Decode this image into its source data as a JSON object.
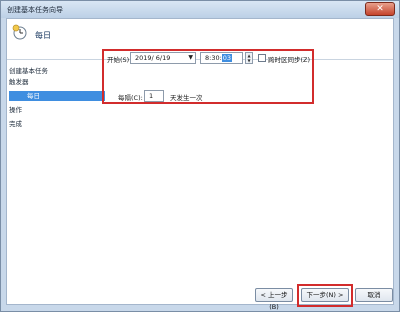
{
  "window": {
    "title": "创建基本任务向导"
  },
  "header": {
    "title": "每日"
  },
  "nav": {
    "items": [
      {
        "label": "创建基本任务"
      },
      {
        "label": "触发器"
      },
      {
        "label": "每日"
      },
      {
        "label": "操作"
      },
      {
        "label": "完成"
      }
    ]
  },
  "form": {
    "start_label": "开始(S):",
    "date_value": "2019/ 6/19",
    "time_prefix": "8:30:",
    "time_selected": "03",
    "sync_label": "跨时区同步(Z)",
    "recur_label": "每隔(C):",
    "recur_value": "1",
    "recur_suffix": "天发生一次"
  },
  "buttons": {
    "back": "< 上一步(B)",
    "next": "下一步(N) >",
    "cancel": "取消"
  },
  "colors": {
    "accent": "#3f8ee0",
    "highlight_border": "#d22c2c"
  }
}
